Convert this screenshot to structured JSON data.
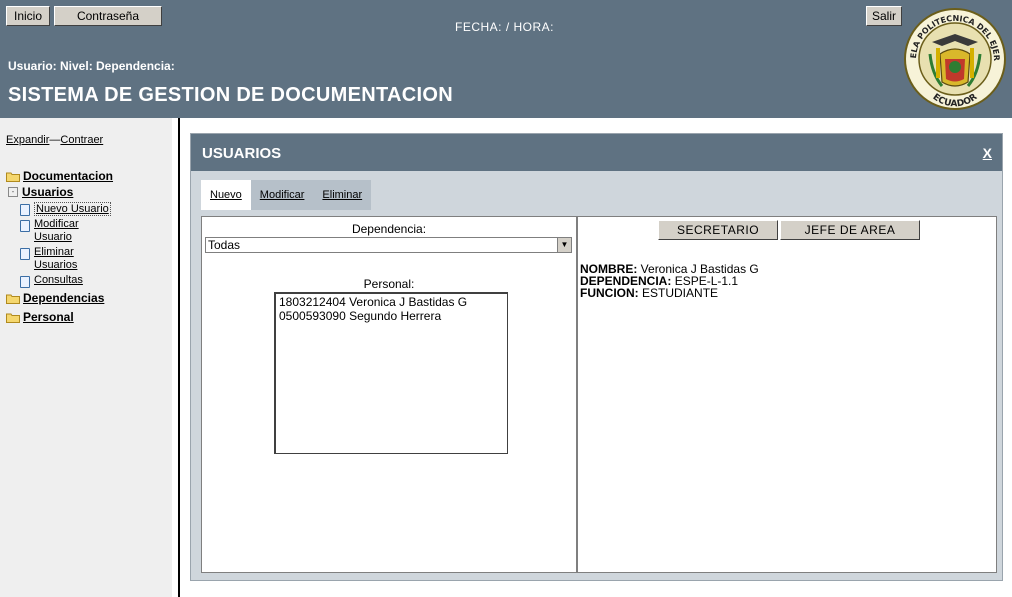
{
  "header": {
    "inicio_label": "Inicio",
    "contrasena_label": "Contraseña",
    "salir_label": "Salir",
    "fecha_hora": "FECHA: / HORA:",
    "user_line": "Usuario: Nivel: Dependencia:",
    "system_title": "SISTEMA DE GESTION DE DOCUMENTACION"
  },
  "logo": {
    "top_text": "ESCUELA POLITECNICA DEL EJERCITO",
    "bottom_text": "ECUADOR"
  },
  "sidebar": {
    "expandir": "Expandir",
    "separator": "—",
    "contraer": "Contraer",
    "documentacion": "Documentacion",
    "usuarios": "Usuarios",
    "nuevo_usuario": "Nuevo Usuario",
    "modificar_usuario": "Modificar Usuario",
    "eliminar_usuarios": "Eliminar Usuarios",
    "consultas": "Consultas",
    "dependencias": "Dependencias",
    "personal": "Personal"
  },
  "main": {
    "title": "USUARIOS",
    "close_label": "X",
    "tabs": [
      {
        "label": "Nuevo",
        "active": true
      },
      {
        "label": "Modificar",
        "active": false
      },
      {
        "label": "Eliminar",
        "active": false
      }
    ]
  },
  "left_panel": {
    "dependencia_label": "Dependencia:",
    "dependencia_value": "Todas",
    "personal_label": "Personal:",
    "personal_list": [
      "1803212404 Veronica J Bastidas G",
      "0500593090 Segundo Herrera"
    ]
  },
  "right_panel": {
    "secretario_label": "SECRETARIO",
    "jefe_label": "JEFE DE AREA",
    "nombre_label": "NOMBRE:",
    "nombre_value": "Veronica J Bastidas G",
    "dependencia_label": "DEPENDENCIA:",
    "dependencia_value": "ESPE-L-1.1",
    "funcion_label": "FUNCION:",
    "funcion_value": "ESTUDIANTE"
  },
  "colors": {
    "header_bg": "#5f7282",
    "panel_bg": "#cfd6dc",
    "button_bg": "#d4d0c8"
  }
}
